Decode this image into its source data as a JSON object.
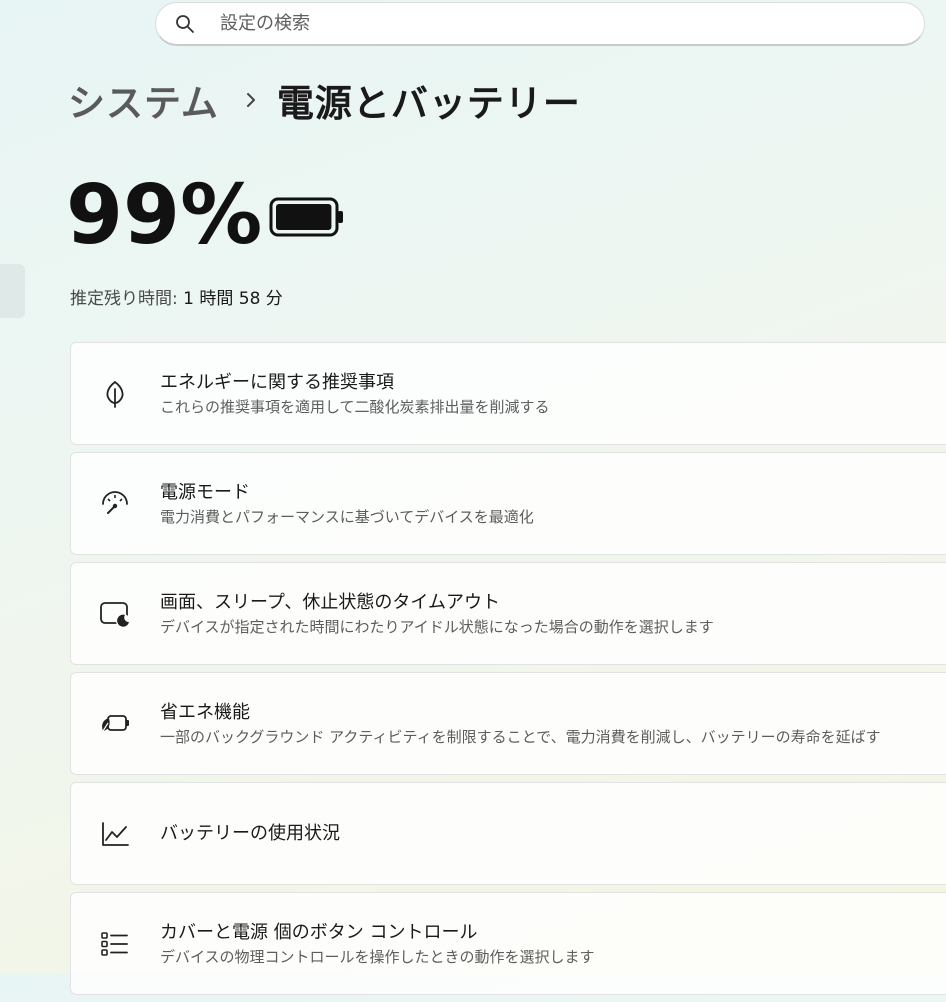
{
  "search": {
    "placeholder": "設定の検索",
    "icon": "search-icon"
  },
  "breadcrumb": {
    "parent": "システム",
    "separator_icon": "chevron-right-icon",
    "current": "電源とバッテリー"
  },
  "battery": {
    "percent_text": "99%",
    "level": 0.99,
    "icon": "battery-icon",
    "estimate_label": "推定残り時間:",
    "estimate_value": "1 時間 58 分"
  },
  "cards": [
    {
      "icon": "leaf-icon",
      "title": "エネルギーに関する推奨事項",
      "subtitle": "これらの推奨事項を適用して二酸化炭素排出量を削減する"
    },
    {
      "icon": "gauge-icon",
      "title": "電源モード",
      "subtitle": "電力消費とパフォーマンスに基づいてデバイスを最適化"
    },
    {
      "icon": "screen-sleep-icon",
      "title": "画面、スリープ、休止状態のタイムアウト",
      "subtitle": "デバイスが指定された時間にわたりアイドル状態になった場合の動作を選択します"
    },
    {
      "icon": "energy-saver-icon",
      "title": "省エネ機能",
      "subtitle": "一部のバックグラウンド アクティビティを制限することで、電力消費を削減し、バッテリーの寿命を延ばす"
    },
    {
      "icon": "line-chart-icon",
      "title": "バッテリーの使用状況",
      "subtitle": ""
    },
    {
      "icon": "list-icon",
      "title": "カバーと電源 個のボタン コントロール",
      "subtitle": "デバイスの物理コントロールを操作したときの動作を選択します"
    }
  ]
}
